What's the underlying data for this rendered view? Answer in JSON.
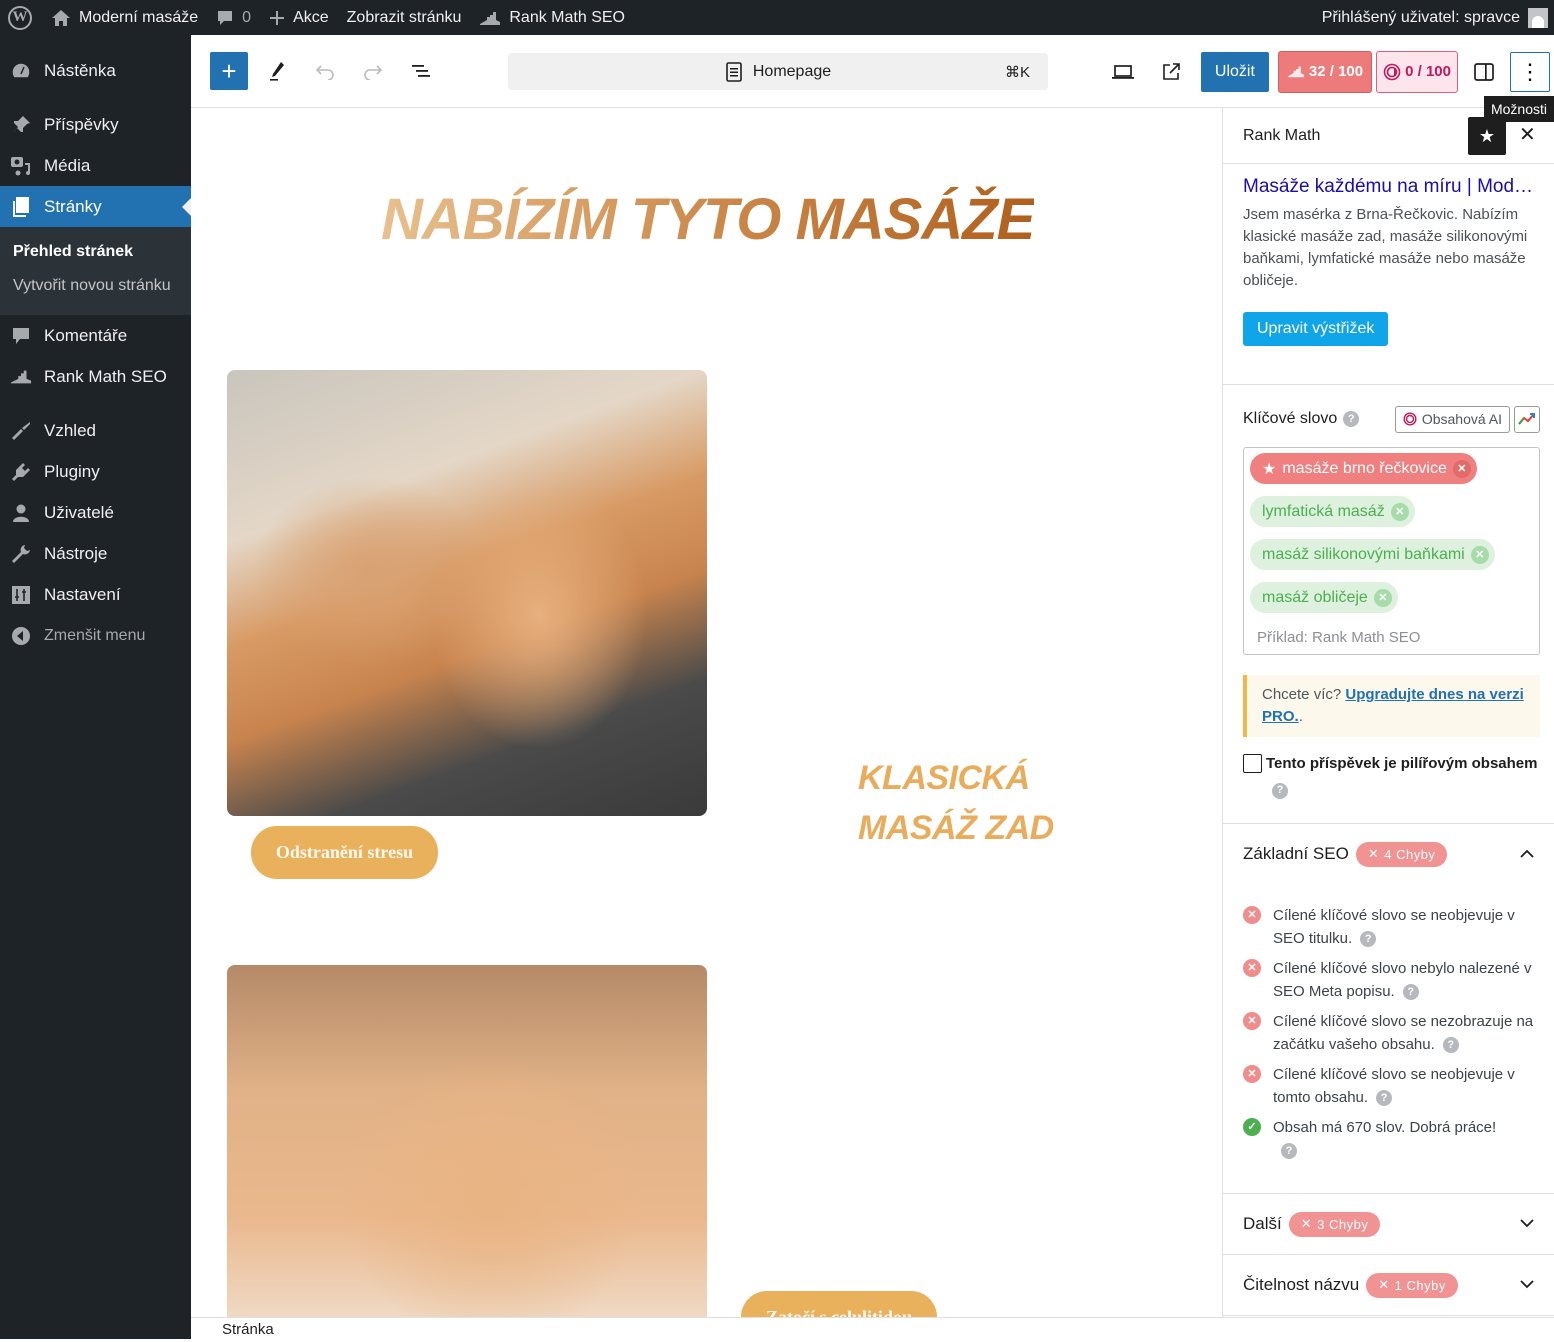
{
  "adminbar": {
    "site_name": "Moderní masáže",
    "comments_count": "0",
    "new_label": "Akce",
    "view_page_label": "Zobrazit stránku",
    "rank_math_label": "Rank Math SEO",
    "user_greeting": "Přihlášený uživatel: spravce"
  },
  "sidebar": {
    "items": [
      {
        "label": "Nástěnka",
        "icon": "dashboard-icon"
      },
      {
        "label": "Příspěvky",
        "icon": "pin-icon"
      },
      {
        "label": "Média",
        "icon": "media-icon"
      },
      {
        "label": "Stránky",
        "icon": "pages-icon",
        "active": true
      },
      {
        "label": "Komentáře",
        "icon": "comment-icon"
      },
      {
        "label": "Rank Math SEO",
        "icon": "rank-math-icon"
      },
      {
        "label": "Vzhled",
        "icon": "paintbrush-icon"
      },
      {
        "label": "Pluginy",
        "icon": "plugin-icon"
      },
      {
        "label": "Uživatelé",
        "icon": "user-icon"
      },
      {
        "label": "Nástroje",
        "icon": "wrench-icon"
      },
      {
        "label": "Nastavení",
        "icon": "settings-icon"
      }
    ],
    "submenu": [
      "Přehled stránek",
      "Vytvořit novou stránku"
    ],
    "collapse_label": "Zmenšit menu"
  },
  "toolbar": {
    "document_title": "Homepage",
    "shortcut": "⌘K",
    "save_label": "Uložit",
    "seo_score": "32 / 100",
    "ai_score": "0 / 100",
    "options_tooltip": "Možnosti"
  },
  "canvas": {
    "heading": "NABÍZÍM TYTO MASÁŽE",
    "section1_title_line1": "KLASICKÁ",
    "section1_title_line2": "MASÁŽ ZAD",
    "section1_button": "Odstranění stresu",
    "section2_button": "Zatočí s celulitidou"
  },
  "footer": {
    "breadcrumb": "Stránka"
  },
  "panel": {
    "title": "Rank Math",
    "snippet": {
      "title": "Masáže každému na míru | Moderní masáže",
      "description": "Jsem masérka z Brna-Řečkovic. Nabízím klasické masáže zad, masáže silikonovými baňkami, lymfatické masáže nebo masáže obličeje.",
      "edit_label": "Upravit výstřižek"
    },
    "keyword": {
      "label": "Klíčové slovo",
      "ai_button": "Obsahová AI",
      "primary": "masáže brno řečkovice",
      "secondary": [
        "lymfatická masáž",
        "masáž silikonovými baňkami",
        "masáž obličeje"
      ],
      "placeholder": "Příklad: Rank Math SEO"
    },
    "notice": {
      "text": "Chcete víc? ",
      "link": "Upgradujte dnes na verzi PRO.",
      "suffix": "."
    },
    "pillar_label": "Tento příspěvek je pilířovým obsahem",
    "pillar_checked": false,
    "sections": [
      {
        "title": "Základní SEO",
        "badge": "4 Chyby",
        "expanded": true,
        "checks": [
          {
            "text": "Cílené klíčové slovo se neobjevuje v SEO titulku.",
            "status": "fail"
          },
          {
            "text": "Cílené klíčové slovo nebylo nalezené v SEO Meta popisu.",
            "status": "fail"
          },
          {
            "text": "Cílené klíčové slovo se nezobrazuje na začátku vašeho obsahu.",
            "status": "fail"
          },
          {
            "text": "Cílené klíčové slovo se neobjevuje v tomto obsahu.",
            "status": "fail"
          },
          {
            "text": "Obsah má 670 slov. Dobrá práce!",
            "status": "pass"
          }
        ]
      },
      {
        "title": "Další",
        "badge": "3 Chyby",
        "expanded": false
      },
      {
        "title": "Čitelnost názvu",
        "badge": "1 Chyby",
        "expanded": false
      }
    ]
  },
  "colors": {
    "accent": "#2271b1",
    "seo_score_bg": "#ee7b7b",
    "ai_score_color": "#c2185b",
    "heading_gold": "#e9ac5c",
    "fail": "#f08c8c",
    "pass": "#4caf50"
  }
}
